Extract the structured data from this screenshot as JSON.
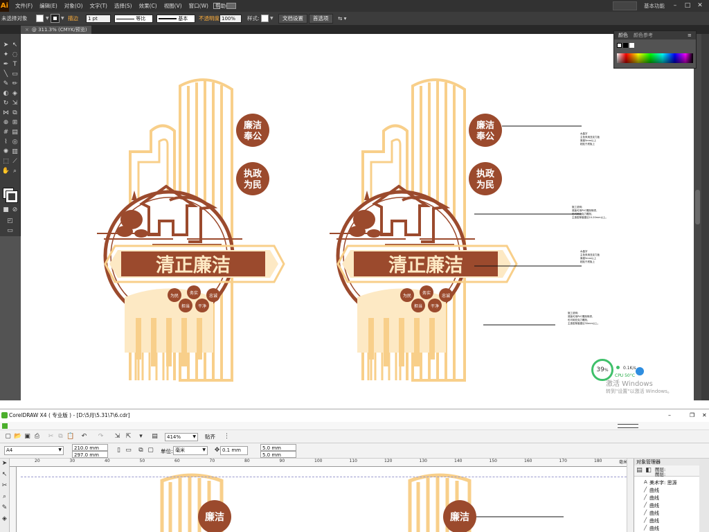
{
  "illustrator": {
    "logo": "Ai",
    "menus": [
      "文件(F)",
      "编辑(E)",
      "对象(O)",
      "文字(T)",
      "选择(S)",
      "效果(C)",
      "视图(V)",
      "窗口(W)",
      "帮助(H)"
    ],
    "workspace": "基本功能",
    "control_bar": {
      "selection_status": "未选择对象",
      "stroke_label": "描边",
      "stroke_weight": "1 pt",
      "profile_label": "等比",
      "brush_label": "基本",
      "opacity_label": "不透明度",
      "opacity_value": "100%",
      "style_label": "样式:",
      "doc_setup_btn": "文档设置",
      "prefs_btn": "首选项"
    },
    "doc_tab": "@ 311.3% (CMYK/预览)",
    "color_panel": {
      "tabs": [
        "颜色",
        "颜色参考"
      ]
    },
    "artwork": {
      "badge_top": "廉洁奉公",
      "badge_mid": "执政为民",
      "banner": "清正廉洁",
      "chips": [
        "为民",
        "务实",
        "忠诚",
        "担当",
        "干净"
      ]
    },
    "callout_notes": {
      "note1": [
        "水晶字",
        "主色采用亚克力板",
        "厚度5mm以上",
        "粘贴于底板上"
      ],
      "note2": [
        "施工说明：",
        "底板可用PVC雕刻喷漆，",
        "也可用亚克力雕刻，",
        "主造型厚度建议10-20mm以上。"
      ],
      "note3": [
        "水晶字",
        "主色采用亚克力板",
        "厚度5mm以上",
        "粘贴于底板上"
      ],
      "note4": [
        "施工说明：",
        "底板可用PVC雕刻喷漆，",
        "也可用亚克力雕刻，",
        "主造型厚度建议30mm以上。"
      ]
    },
    "colors": {
      "brand_brown": "#9b4a2d",
      "gold_light": "#f8cf8a",
      "cream": "#fde9c4",
      "ui_dark": "#535353"
    }
  },
  "perf_widget": {
    "cpu_percent": "39",
    "percent_sign": "%",
    "net": "0.1K/s",
    "cpu_temp": "CPU 50°C"
  },
  "activation": {
    "title": "激活 Windows",
    "subtitle": "转到\"设置\"以激活 Windows。"
  },
  "coreldraw": {
    "title": "CorelDRAW X4 ( 专业版 ) - [D:\\5月\\5.31\\7\\6.cdr]",
    "zoom": "414%",
    "snap_label": "贴齐",
    "page_size": "A4",
    "width": "210.0 mm",
    "height": "297.0 mm",
    "unit_label": "单位:",
    "unit_value": "毫米",
    "nudge": "0.1 mm",
    "dup_x": "5.0 mm",
    "dup_y": "5.0 mm",
    "ruler_ticks": [
      "20",
      "30",
      "40",
      "50",
      "60",
      "70",
      "80",
      "90",
      "100",
      "110",
      "120",
      "130",
      "140",
      "150",
      "160",
      "170",
      "180"
    ],
    "ruler_unit": "毫米",
    "object_manager": {
      "title": "对象管理器",
      "layer_label": "图层:",
      "layer_label2": "图层:",
      "rows": [
        "美术字: 思源",
        "曲线",
        "曲线",
        "曲线",
        "曲线",
        "曲线",
        "曲线"
      ]
    },
    "artwork": {
      "badge": "廉洁奉公"
    }
  }
}
